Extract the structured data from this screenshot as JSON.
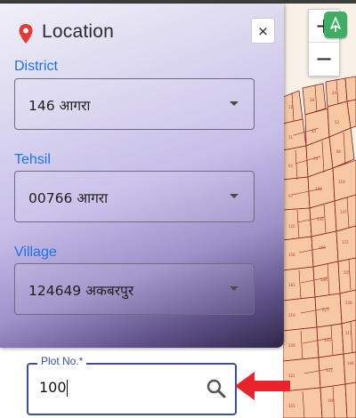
{
  "panel": {
    "title": "Location",
    "close_label": "×",
    "icon": "location-pin-icon"
  },
  "fields": {
    "district": {
      "label": "District",
      "value": "146 आगरा"
    },
    "tehsil": {
      "label": "Tehsil",
      "value": "00766 आगरा"
    },
    "village": {
      "label": "Village",
      "value": "124649 अकबरपुर"
    }
  },
  "plot": {
    "label": "Plot No.*",
    "value": "100",
    "icon": "search-icon"
  },
  "map": {
    "zoom_in_label": "+",
    "zoom_out_label": "−",
    "compass_icon": "north-arrow-icon"
  },
  "annotation": {
    "icon": "red-arrow-icon",
    "color": "#e8232b"
  },
  "colors": {
    "accent": "#1a73e8",
    "field_border": "#3b4fa1",
    "compass": "#3fae62",
    "map_parcel": "#f6c9a4",
    "map_line": "#8b1a1a"
  }
}
